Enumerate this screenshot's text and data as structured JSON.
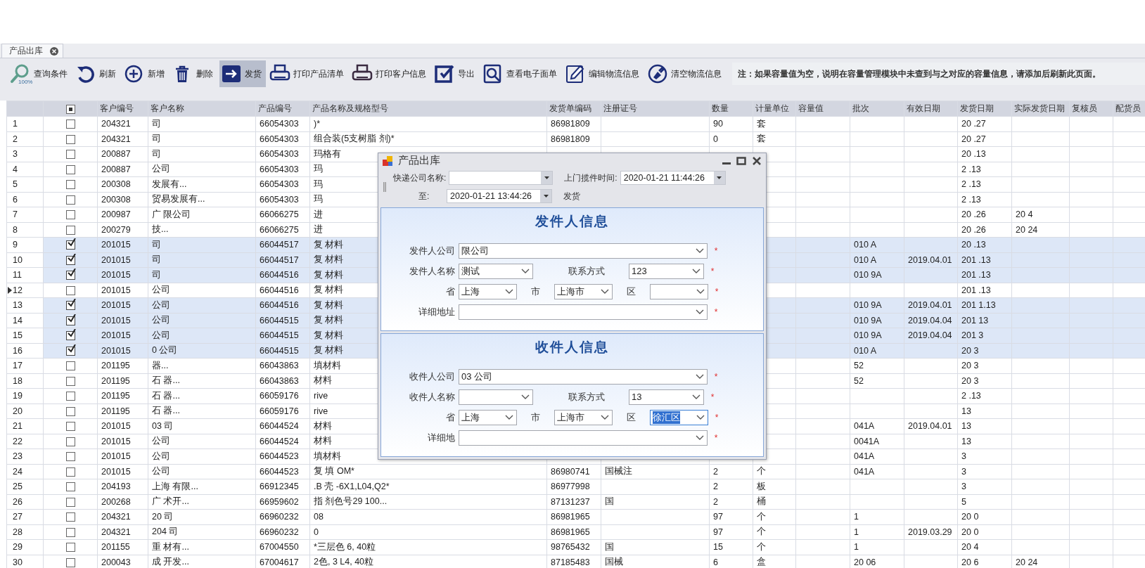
{
  "tab_bar": {
    "tabs": [
      {
        "label": "产品出库",
        "selected": true
      }
    ]
  },
  "toolbar": {
    "buttons": [
      {
        "kind": "query",
        "label": "查询条件",
        "badge": "100%",
        "selected": false
      },
      {
        "kind": "refresh",
        "label": "刷新",
        "selected": false
      },
      {
        "kind": "add",
        "label": "新增",
        "selected": false
      },
      {
        "kind": "delete",
        "label": "删除",
        "selected": false
      },
      {
        "kind": "ship",
        "label": "发货",
        "selected": true
      },
      {
        "kind": "print",
        "label": "打印产品清单",
        "selected": false
      },
      {
        "kind": "print2",
        "label": "打印客户信息",
        "selected": false
      },
      {
        "kind": "export",
        "label": "导出",
        "selected": false
      },
      {
        "kind": "view",
        "label": "查看电子面单",
        "selected": false
      },
      {
        "kind": "edit",
        "label": "编辑物流信息",
        "selected": false
      },
      {
        "kind": "clear",
        "label": "清空物流信息",
        "selected": false
      }
    ],
    "note": "注：如果容量值为空，说明在容量管理模块中未查到与之对应的容量信息，请添加后刷新此页面。"
  },
  "table": {
    "select_all_mixed": true,
    "columns": [
      "客户编号",
      "客户名称",
      "产品编号",
      "产品名称及规格型号",
      "发货单编码",
      "注册证号",
      "数量",
      "计量单位",
      "容量值",
      "批次",
      "有效日期",
      "发货日期",
      "实际发货日期",
      "复核员",
      "配货员"
    ],
    "rows": [
      {
        "number": "1",
        "checked": false,
        "current": false,
        "cells": {
          "customer_no": "204321",
          "customer_name": "司",
          "product_no": "66054303",
          "product_name": ")*",
          "invoice_no": "86981809",
          "quantity": "90",
          "unit": "套",
          "ship_date": "20 .27"
        }
      },
      {
        "number": "2",
        "checked": false,
        "current": false,
        "cells": {
          "customer_no": "204321",
          "customer_name": "司",
          "product_no": "66054303",
          "product_name": "组合装(5支树脂 剂)*",
          "invoice_no": "86981809",
          "quantity": "0",
          "unit": "套",
          "ship_date": "20 .27"
        }
      },
      {
        "number": "3",
        "checked": false,
        "current": false,
        "cells": {
          "customer_no": "200887",
          "customer_name": "司",
          "product_no": "66054303",
          "product_name": "玛格有",
          "ship_date": "20 .13"
        }
      },
      {
        "number": "4",
        "checked": false,
        "current": false,
        "cells": {
          "customer_no": "200887",
          "customer_name": "公司",
          "product_no": "66054303",
          "product_name": "玛",
          "ship_date": "2 .13"
        }
      },
      {
        "number": "5",
        "checked": false,
        "current": false,
        "cells": {
          "customer_no": "200308",
          "customer_name": "发展有...",
          "product_no": "66054303",
          "product_name": "玛",
          "ship_date": "2 .13"
        }
      },
      {
        "number": "6",
        "checked": false,
        "current": false,
        "cells": {
          "customer_no": "200308",
          "customer_name": "贸易发展有...",
          "product_no": "66054303",
          "product_name": "玛",
          "ship_date": "2 .13"
        }
      },
      {
        "number": "7",
        "checked": false,
        "current": false,
        "cells": {
          "customer_no": "200987",
          "customer_name": "广 限公司",
          "product_no": "66066275",
          "product_name": "进",
          "ship_date": "20 .26",
          "actual_ship_date": "20 4"
        }
      },
      {
        "number": "8",
        "checked": false,
        "current": false,
        "cells": {
          "customer_no": "200279",
          "customer_name": "技...",
          "product_no": "66066275",
          "product_name": "进",
          "ship_date": "20 .26",
          "actual_ship_date": "20 24"
        }
      },
      {
        "number": "9",
        "checked": true,
        "current": false,
        "cells": {
          "customer_no": "201015",
          "customer_name": "司",
          "product_no": "66044517",
          "product_name": "复 材料",
          "batch": "010 A",
          "ship_date": "20 .13"
        }
      },
      {
        "number": "10",
        "checked": true,
        "current": false,
        "cells": {
          "customer_no": "201015",
          "customer_name": "司",
          "product_no": "66044517",
          "product_name": "复 材料",
          "batch": "010 A",
          "expiry_date": "2019.04.01",
          "ship_date": "201 .13"
        }
      },
      {
        "number": "11",
        "checked": true,
        "current": false,
        "cells": {
          "customer_no": "201015",
          "customer_name": "司",
          "product_no": "66044516",
          "product_name": "复 材料",
          "batch": "010 9A",
          "ship_date": "201 .13"
        }
      },
      {
        "number": "12",
        "checked": false,
        "current": true,
        "cells": {
          "customer_no": "201015",
          "customer_name": "公司",
          "product_no": "66044516",
          "product_name": "复 材料",
          "ship_date": "201 .13"
        }
      },
      {
        "number": "13",
        "checked": true,
        "current": false,
        "cells": {
          "customer_no": "201015",
          "customer_name": "公司",
          "product_no": "66044516",
          "product_name": "复 材料",
          "batch": "010 9A",
          "expiry_date": "2019.04.01",
          "ship_date": "201 1.13"
        }
      },
      {
        "number": "14",
        "checked": true,
        "current": false,
        "cells": {
          "customer_no": "201015",
          "customer_name": "公司",
          "product_no": "66044515",
          "product_name": "复 材料",
          "batch": "010 9A",
          "expiry_date": "2019.04.04",
          "ship_date": "201 13"
        }
      },
      {
        "number": "15",
        "checked": true,
        "current": false,
        "cells": {
          "customer_no": "201015",
          "customer_name": "公司",
          "product_no": "66044515",
          "product_name": "复 材料",
          "batch": "010 9A",
          "expiry_date": "2019.04.04",
          "ship_date": "201 3"
        }
      },
      {
        "number": "16",
        "checked": true,
        "current": false,
        "cells": {
          "customer_no": "201015",
          "customer_name": "0 公司",
          "product_no": "66044515",
          "product_name": "复 材料",
          "batch": "010 A",
          "ship_date": "20 3"
        }
      },
      {
        "number": "17",
        "checked": false,
        "current": false,
        "cells": {
          "customer_no": "201195",
          "customer_name": "器...",
          "product_no": "66043863",
          "product_name": "填材料",
          "batch": "52",
          "ship_date": "20 3"
        }
      },
      {
        "number": "18",
        "checked": false,
        "current": false,
        "cells": {
          "customer_no": "201195",
          "customer_name": "石 器...",
          "product_no": "66043863",
          "product_name": "材料",
          "batch": "52",
          "ship_date": "20 3"
        }
      },
      {
        "number": "19",
        "checked": false,
        "current": false,
        "cells": {
          "customer_no": "201195",
          "customer_name": "石 器...",
          "product_no": "66059176",
          "product_name": "rive",
          "ship_date": "2 .13"
        }
      },
      {
        "number": "20",
        "checked": false,
        "current": false,
        "cells": {
          "customer_no": "201195",
          "customer_name": "石 器...",
          "product_no": "66059176",
          "product_name": "rive",
          "ship_date": "13"
        }
      },
      {
        "number": "21",
        "checked": false,
        "current": false,
        "cells": {
          "customer_no": "201015",
          "customer_name": "03 司",
          "product_no": "66044524",
          "product_name": "材料",
          "batch": "041A",
          "expiry_date": "2019.04.01",
          "ship_date": "13"
        }
      },
      {
        "number": "22",
        "checked": false,
        "current": false,
        "cells": {
          "customer_no": "201015",
          "customer_name": "公司",
          "product_no": "66044524",
          "product_name": "材料",
          "batch": "0041A",
          "ship_date": "13"
        }
      },
      {
        "number": "23",
        "checked": false,
        "current": false,
        "cells": {
          "customer_no": "201015",
          "customer_name": "公司",
          "product_no": "66044523",
          "product_name": "填材料",
          "batch": "041A",
          "ship_date": "3"
        }
      },
      {
        "number": "24",
        "checked": false,
        "current": false,
        "cells": {
          "customer_no": "201015",
          "customer_name": "公司",
          "product_no": "66044523",
          "product_name": "复 填 OM*",
          "invoice_no": "86980741",
          "registration_no": "国械注",
          "quantity": "2",
          "unit": "个",
          "batch": "041A",
          "ship_date": "3"
        }
      },
      {
        "number": "25",
        "checked": false,
        "current": false,
        "cells": {
          "customer_no": "204193",
          "customer_name": "上海 有限...",
          "product_no": "66912345",
          "product_name": ".B 壳 -6X1,L04,Q2*",
          "invoice_no": "86977998",
          "quantity": "2",
          "unit": "板",
          "ship_date": "3"
        }
      },
      {
        "number": "26",
        "checked": false,
        "current": false,
        "cells": {
          "customer_no": "200268",
          "customer_name": "广 术开...",
          "product_no": "66959602",
          "product_name": "指 剂色号29  100...",
          "invoice_no": "87131237",
          "registration_no": "国",
          "quantity": "2",
          "unit": "桶",
          "ship_date": "5"
        }
      },
      {
        "number": "27",
        "checked": false,
        "current": false,
        "cells": {
          "customer_no": "204321",
          "customer_name": "20 司",
          "product_no": "66960232",
          "product_name": "08",
          "invoice_no": "86981965",
          "quantity": "97",
          "unit": "个",
          "batch": "1",
          "ship_date": "20 0"
        }
      },
      {
        "number": "28",
        "checked": false,
        "current": false,
        "cells": {
          "customer_no": "204321",
          "customer_name": "204 司",
          "product_no": "66960232",
          "product_name": "0",
          "invoice_no": "86981965",
          "quantity": "97",
          "unit": "个",
          "batch": "1",
          "expiry_date": "2019.03.29",
          "ship_date": "20 0"
        }
      },
      {
        "number": "29",
        "checked": false,
        "current": false,
        "cells": {
          "customer_no": "201155",
          "customer_name": "重 材有...",
          "product_no": "67004550",
          "product_name": "*三层色 6, 40粒",
          "invoice_no": "98765432",
          "registration_no": "国",
          "quantity": "15",
          "unit": "个",
          "batch": "1",
          "ship_date": "20 4"
        }
      },
      {
        "number": "30",
        "checked": false,
        "current": false,
        "cells": {
          "customer_no": "200043",
          "customer_name": "成 开发...",
          "product_no": "67004617",
          "product_name": "2色, 3 L4, 40粒",
          "invoice_no": "87185483",
          "registration_no": "国械",
          "quantity": "6",
          "unit": "盒",
          "batch": "20 06",
          "ship_date": "20 6",
          "actual_ship_date": "20 24"
        }
      }
    ]
  },
  "dialog": {
    "title": "产品出库",
    "courier": {
      "label": "快递公司名称:"
    },
    "pickup_time": {
      "label": "上门揽件时间:",
      "value": "2020-01-21 11:44:26"
    },
    "until": {
      "label": "至:",
      "value": "2020-01-21 13:44:26"
    },
    "ship_button": "发货",
    "panels": [
      {
        "title": "发件人信息",
        "company": {
          "label": "发件人公司",
          "value": "限公司",
          "required": "*"
        },
        "name": {
          "label": "发件人名称",
          "value": "测试"
        },
        "phone": {
          "label": "联系方式",
          "value": "123",
          "required": "*"
        },
        "province": {
          "label": "省",
          "value": "上海"
        },
        "city": {
          "label": "市",
          "value": "上海市"
        },
        "district": {
          "label": "区",
          "focused": false,
          "required": "*"
        },
        "address": {
          "label": "详细地址",
          "required": "*"
        }
      },
      {
        "title": "收件人信息",
        "company": {
          "label": "收件人公司",
          "value": "03 公司",
          "required": "*"
        },
        "name": {
          "label": "收件人名称"
        },
        "phone": {
          "label": "联系方式",
          "value": "13",
          "required": "*"
        },
        "province": {
          "label": "省",
          "value": "上海"
        },
        "city": {
          "label": "市",
          "value": "上海市"
        },
        "district": {
          "label": "区",
          "value": "徐汇区",
          "focused": true,
          "required": "*"
        },
        "address": {
          "label": "详细地",
          "required": "*"
        }
      }
    ]
  }
}
